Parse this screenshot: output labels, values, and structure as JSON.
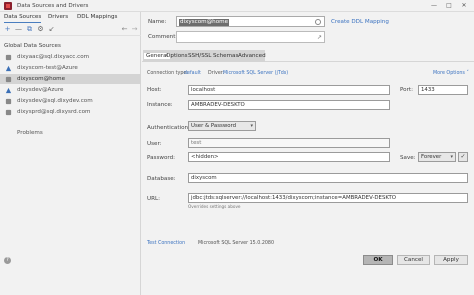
{
  "window": {
    "title": "Data Sources and Drivers",
    "minimize": "—",
    "maximize": "□",
    "close": "✕"
  },
  "left_tabs": [
    "Data Sources",
    "Drivers",
    "DDL Mappings"
  ],
  "toolbar_icons": [
    "add-icon",
    "remove-icon",
    "duplicate-icon",
    "settings-icon",
    "import-icon",
    "back-icon",
    "forward-icon"
  ],
  "section_title": "Global Data Sources",
  "data_sources": [
    {
      "label": "dixyaac@sql.dixyacc.com",
      "selected": false
    },
    {
      "label": "dixyscom-test@Azure",
      "selected": false
    },
    {
      "label": "dixyscom@home",
      "selected": true
    },
    {
      "label": "dixysdev@Azure",
      "selected": false
    },
    {
      "label": "dixysdev@sql.dixydev.com",
      "selected": false
    },
    {
      "label": "dixysprd@sql.dixysrd.com",
      "selected": false
    }
  ],
  "problems_label": "Problems",
  "form": {
    "name_label": "Name:",
    "name_value": "dixyscom@home",
    "create_ddl_link": "Create DDL Mapping",
    "comment_label": "Comment:",
    "tabs": [
      "General",
      "Options",
      "SSH/SSL",
      "Schemas",
      "Advanced"
    ],
    "connection_type_label": "Connection type:",
    "connection_type_value": "default",
    "driver_label": "Driver:",
    "driver_value": "Microsoft SQL Server (jTds)",
    "more_options": "More Options",
    "host_label": "Host:",
    "host_value": "localhost",
    "port_label": "Port:",
    "port_value": "1433",
    "instance_label": "Instance:",
    "instance_value": "AMBRADEV-DESKTO",
    "auth_label": "Authentication:",
    "auth_value": "User & Password",
    "user_label": "User:",
    "user_value": "test",
    "password_label": "Password:",
    "password_value": "<hidden>",
    "save_label": "Save:",
    "save_value": "Forever",
    "database_label": "Database:",
    "database_value": "dixyscom",
    "url_label": "URL:",
    "url_value": "jdbc:jtds:sqlserver://localhost:1433/dixyscom;instance=AMBRADEV-DESKTO",
    "url_hint": "Overrides settings above"
  },
  "status": {
    "test_connection": "Test Connection",
    "server_version": "Microsoft SQL Server 15.0.2080"
  },
  "buttons": {
    "help": "?",
    "ok": "OK",
    "cancel": "Cancel",
    "apply": "Apply"
  }
}
